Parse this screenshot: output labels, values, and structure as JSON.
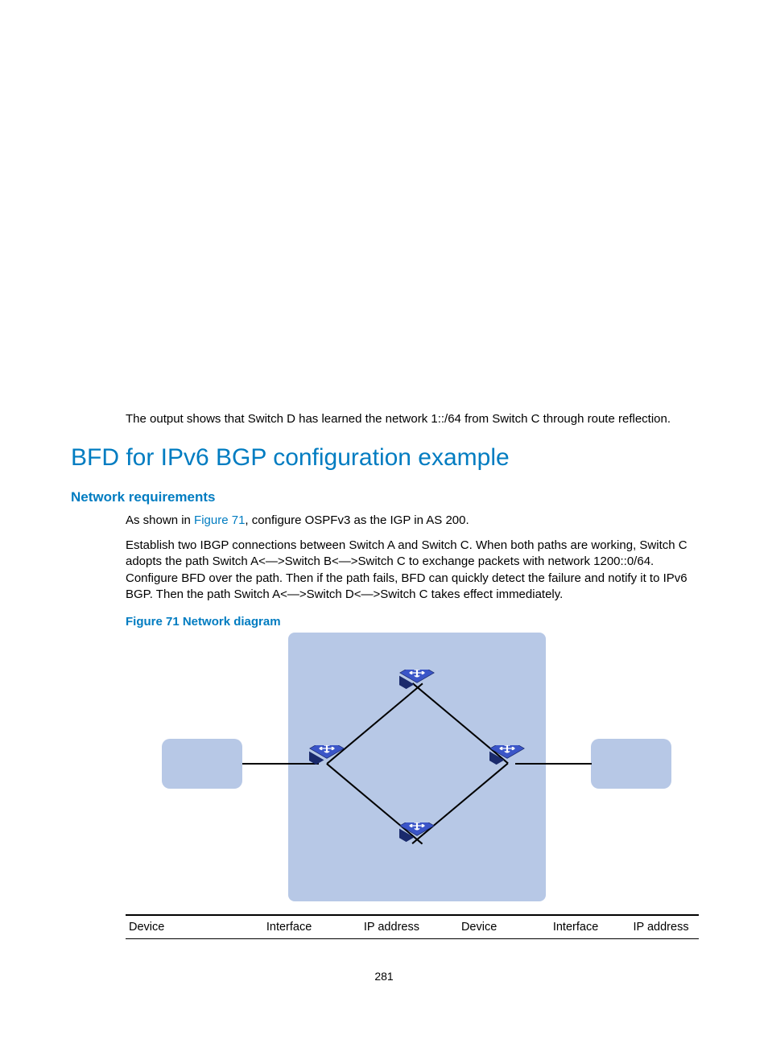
{
  "intro": "The output shows that Switch D has learned the network 1::/64 from Switch C through route reflection.",
  "h1": "BFD for IPv6 BGP configuration example",
  "h2": "Network requirements",
  "para1": {
    "prefix": "As shown in ",
    "link": "Figure 71",
    "suffix": ", configure OSPFv3 as the IGP in AS 200."
  },
  "para2": "Establish two IBGP connections between Switch A and Switch C. When both paths are working, Switch C adopts the path Switch A<—>Switch B<—>Switch C to exchange packets with network 1200::0/64. Configure BFD over the path. Then if the path fails, BFD can quickly detect the failure and notify it to IPv6 BGP. Then the path Switch A<—>Switch D<—>Switch C takes effect immediately.",
  "fig_caption": "Figure 71 Network diagram",
  "table": {
    "headers": [
      "Device",
      "Interface",
      "IP address",
      "Device",
      "Interface",
      "IP address"
    ]
  },
  "pagenum": "281"
}
